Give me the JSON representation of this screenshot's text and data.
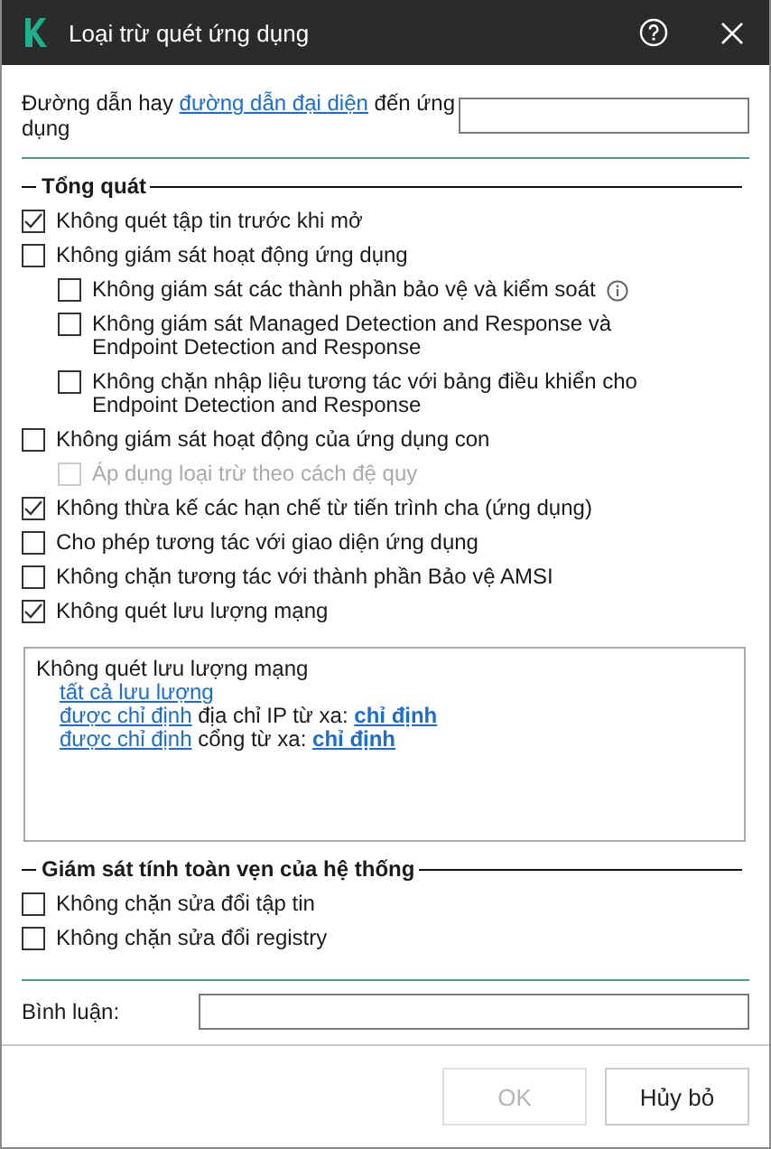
{
  "window": {
    "title": "Loại trừ quét ứng dụng"
  },
  "path": {
    "before": "Đường dẫn hay ",
    "link": "đường dẫn đại diện",
    "after": " đến ứng dụng"
  },
  "sections": [
    {
      "title": "Tổng quát",
      "options": [
        {
          "label": "Không quét tập tin trước khi mở",
          "checked": true,
          "disabled": false
        },
        {
          "label": "Không giám sát hoạt động ứng dụng",
          "checked": false,
          "disabled": false,
          "children": [
            {
              "label": "Không giám sát các thành phần bảo vệ và kiểm soát",
              "checked": false,
              "disabled": false,
              "info": true
            },
            {
              "label": "Không giám sát Managed Detection and Response và Endpoint Detection and Response",
              "checked": false,
              "disabled": false
            },
            {
              "label": "Không chặn nhập liệu tương tác với bảng điều khiển cho Endpoint Detection and Response",
              "checked": false,
              "disabled": false
            }
          ]
        },
        {
          "label": "Không giám sát hoạt động của ứng dụng con",
          "checked": false,
          "disabled": false,
          "children": [
            {
              "label": "Áp dụng loại trừ theo cách đệ quy",
              "checked": false,
              "disabled": true
            }
          ]
        },
        {
          "label": "Không thừa kế các hạn chế từ tiến trình cha (ứng dụng)",
          "checked": true,
          "disabled": false
        },
        {
          "label": "Cho phép tương tác với giao diện ứng dụng",
          "checked": false,
          "disabled": false
        },
        {
          "label": "Không chặn tương tác với thành phần Bảo vệ AMSI",
          "checked": false,
          "disabled": false
        },
        {
          "label": "Không quét lưu lượng mạng",
          "checked": true,
          "disabled": false
        }
      ],
      "details": {
        "title": "Không quét lưu lượng mạng",
        "lines": [
          {
            "parts": [
              {
                "kind": "link",
                "text": "tất cả lưu lượng"
              }
            ]
          },
          {
            "parts": [
              {
                "kind": "link",
                "text": "được chỉ định"
              },
              {
                "kind": "text",
                "text": " địa chỉ IP từ xa: "
              },
              {
                "kind": "strong-link",
                "text": "chỉ định"
              }
            ]
          },
          {
            "parts": [
              {
                "kind": "link",
                "text": "được chỉ định"
              },
              {
                "kind": "text",
                "text": " cổng từ xa: "
              },
              {
                "kind": "strong-link",
                "text": "chỉ định"
              }
            ]
          }
        ]
      }
    },
    {
      "title": "Giám sát tính toàn vẹn của hệ thống",
      "options": [
        {
          "label": "Không chặn sửa đổi tập tin",
          "checked": false,
          "disabled": false
        },
        {
          "label": "Không chặn sửa đổi registry",
          "checked": false,
          "disabled": false
        }
      ]
    }
  ],
  "comment": {
    "label": "Bình luận:"
  },
  "buttons": [
    {
      "label": "OK",
      "disabled": true
    },
    {
      "label": "Hủy bỏ",
      "disabled": false
    }
  ]
}
